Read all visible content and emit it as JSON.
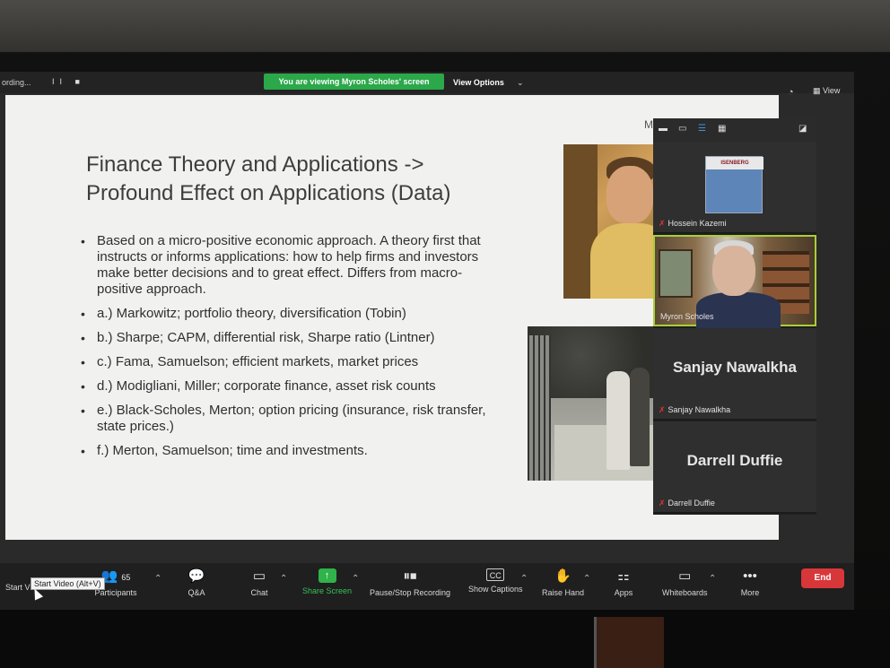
{
  "top_bar": {
    "recording_text": "ording...",
    "recording_controls": "II ■",
    "viewing_banner": "You are viewing Myron Scholes' screen",
    "view_options_label": "View Options",
    "view_label": "View"
  },
  "slide": {
    "corner_text": "M",
    "title_line1": "Finance Theory and Applications ->",
    "title_line2": "Profound Effect on Applications (Data)",
    "bullets": [
      "Based on a micro-positive economic approach.  A theory first that instructs or informs applications: how to help firms and investors make better decisions and to great effect.  Differs from macro-positive approach.",
      "a.) Markowitz; portfolio theory, diversification (Tobin)",
      "b.) Sharpe; CAPM, differential risk, Sharpe ratio (Lintner)",
      "c.) Fama, Samuelson; efficient markets, market prices",
      "d.) Modigliani, Miller; corporate finance, asset risk counts",
      "e.) Black-Scholes, Merton; option pricing (insurance, risk transfer, state prices.)",
      "f.)  Merton, Samuelson; time and investments."
    ]
  },
  "gallery": {
    "participants": [
      {
        "name": "Hossein Kazemi",
        "logo_text": "ISENBERG"
      },
      {
        "name": "Myron Scholes"
      },
      {
        "name": "Sanjay Nawalkha",
        "big_name": "Sanjay Nawalkha"
      },
      {
        "name": "Darrell Duffie",
        "big_name": "Darrell Duffie"
      }
    ]
  },
  "toolbar": {
    "start_video": "Start Video",
    "start_video_tooltip": "Start Video (Alt+V)",
    "participants": "Participants",
    "participants_count": "65",
    "qa": "Q&A",
    "chat": "Chat",
    "share_screen": "Share Screen",
    "pause_stop_recording": "Pause/Stop Recording",
    "show_captions": "Show Captions",
    "raise_hand": "Raise Hand",
    "apps": "Apps",
    "whiteboards": "Whiteboards",
    "more": "More",
    "end": "End"
  },
  "colors": {
    "banner_green": "#2ba84a",
    "end_red": "#d8373a",
    "active_speaker_border": "#a8cf38"
  }
}
